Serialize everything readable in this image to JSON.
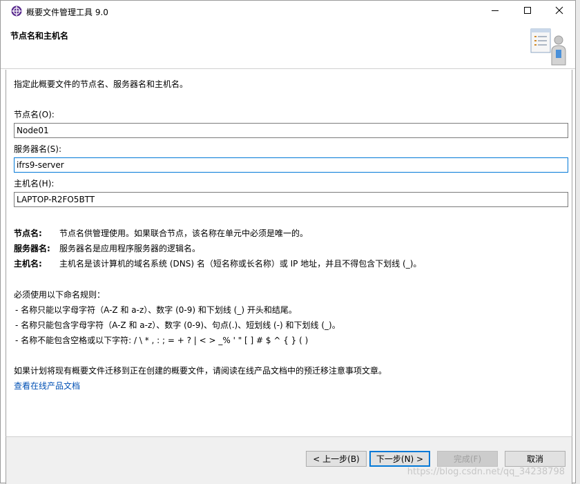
{
  "window": {
    "title": "概要文件管理工具 9.0"
  },
  "header": {
    "title": "节点名和主机名"
  },
  "content": {
    "description": "指定此概要文件的节点名、服务器名和主机名。",
    "fields": {
      "node": {
        "label": "节点名(O):",
        "value": "Node01"
      },
      "server": {
        "label": "服务器名(S):",
        "value": "ifrs9-server"
      },
      "host": {
        "label": "主机名(H):",
        "value": "LAPTOP-R2FO5BTT"
      }
    },
    "info": [
      {
        "key": "节点名:",
        "value": "节点名供管理使用。如果联合节点，该名称在单元中必须是唯一的。"
      },
      {
        "key": "服务器名:",
        "value": "服务器名是应用程序服务器的逻辑名。"
      },
      {
        "key": "主机名:",
        "value": "主机名是该计算机的域名系统 (DNS) 名（短名称或长名称）或 IP 地址，并且不得包含下划线 (_)。"
      }
    ],
    "rules_heading": "必须使用以下命名规则：",
    "rules": [
      "-  名称只能以字母字符（A-Z 和 a-z）、数字 (0-9) 和下划线 (_) 开头和结尾。",
      "-  名称只能包含字母字符（A-Z 和 a-z）、数字 (0-9)、句点(.)、短划线 (-) 和下划线 (_)。",
      "-  名称不能包含空格或以下字符: / \\ * , : ; = + ? | < > _% ' \" [ ] # $ ^ { } ( )"
    ],
    "migration_note": "如果计划将现有概要文件迁移到正在创建的概要文件，请阅读在线产品文档中的预迁移注意事项文章。",
    "doc_link": "查看在线产品文档"
  },
  "footer": {
    "back": "< 上一步(B)",
    "next": "下一步(N) >",
    "finish": "完成(F)",
    "cancel": "取消"
  },
  "watermark": "https://blog.csdn.net/qq_34238798"
}
